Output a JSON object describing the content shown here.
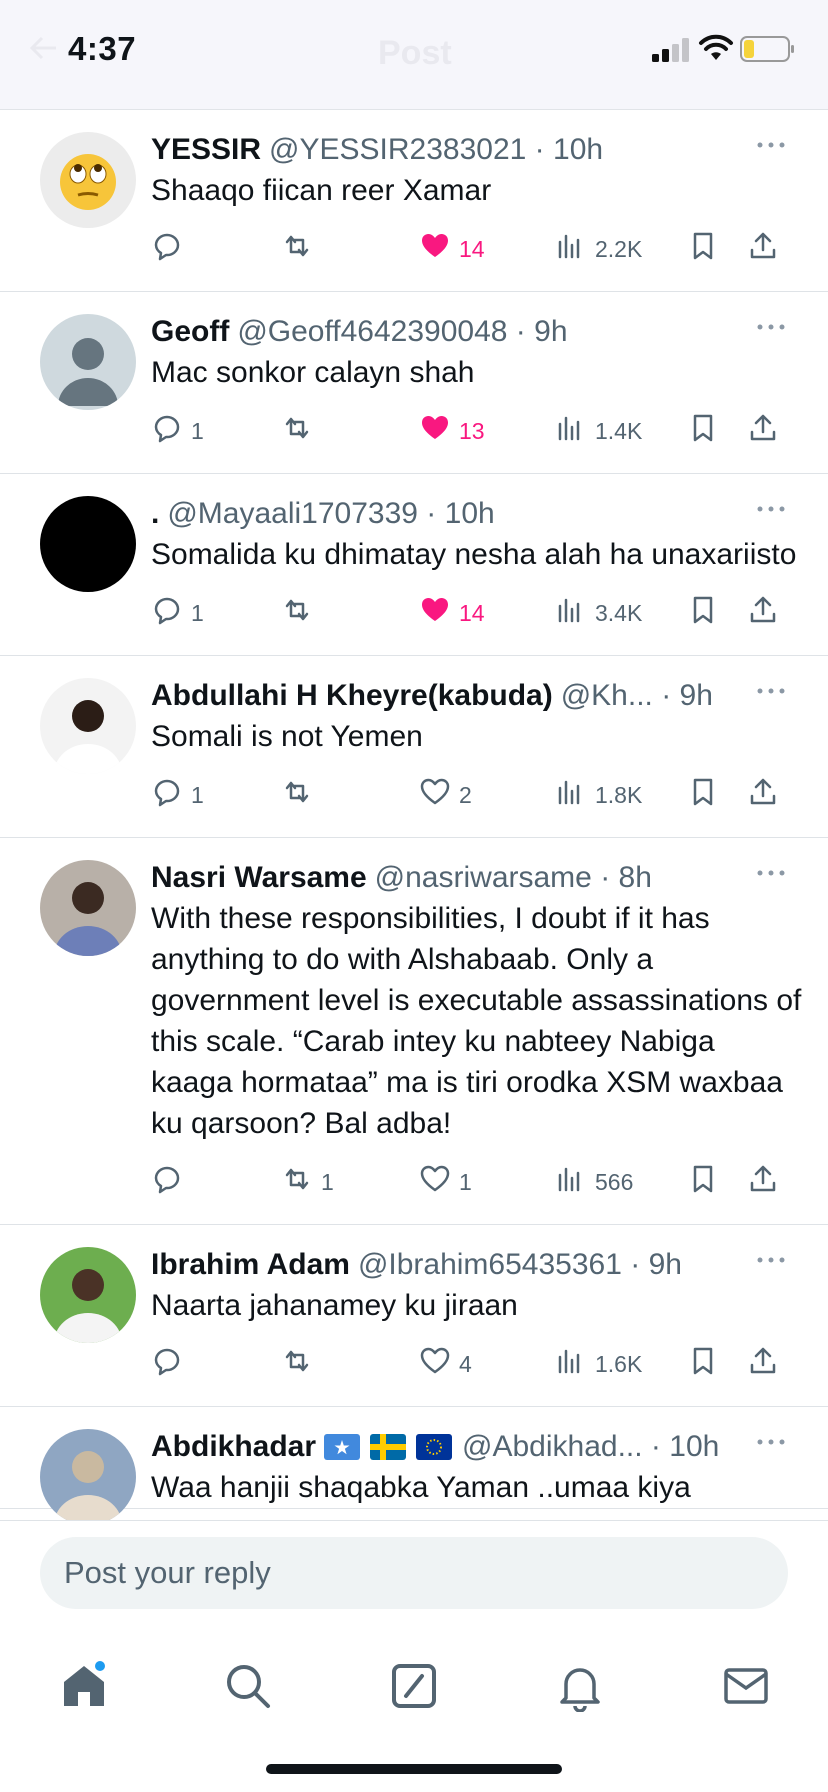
{
  "status_bar": {
    "time": "4:37",
    "faded_title": "Post",
    "battery_color": "#f5d33b"
  },
  "colors": {
    "like_active": "#f91880",
    "secondary_text": "#536471",
    "accent": "#1d9bf0"
  },
  "tweets": [
    {
      "name": "YESSIR",
      "handle": "@YESSIR2383021",
      "time": "10h",
      "text": "Shaaqo fiican reer Xamar",
      "replies": "",
      "retweets": "",
      "likes": "14",
      "liked": true,
      "views": "2.2K",
      "avatar": "face-with-rolling-eyes-emoji"
    },
    {
      "name": "Geoff",
      "handle": "@Geoff4642390048",
      "time": "9h",
      "text": "Mac sonkor calayn shah",
      "replies": "1",
      "retweets": "",
      "likes": "13",
      "liked": true,
      "views": "1.4K",
      "avatar": "default-avatar"
    },
    {
      "name": ".",
      "handle": "@Mayaali1707339",
      "time": "10h",
      "text": "Somalida ku dhimatay nesha  alah ha unaxariisto",
      "replies": "1",
      "retweets": "",
      "likes": "14",
      "liked": true,
      "views": "3.4K",
      "avatar": "black-avatar"
    },
    {
      "name": "Abdullahi H Kheyre(kabuda)",
      "handle": "@Kh...",
      "time": "9h",
      "text": "Somali is not Yemen",
      "replies": "1",
      "retweets": "",
      "likes": "2",
      "liked": false,
      "views": "1.8K",
      "avatar": "photo-avatar"
    },
    {
      "name": "Nasri Warsame",
      "handle": "@nasriwarsame",
      "time": "8h",
      "text": "With these responsibilities, I doubt if it has anything to do with Alshabaab. Only a government level is executable assassinations of this scale. “Carab intey ku nabteey Nabiga kaaga hormataa” ma is tiri orodka XSM waxbaa ku qarsoon? Bal adba!",
      "replies": "",
      "retweets": "1",
      "likes": "1",
      "liked": false,
      "views": "566",
      "avatar": "photo-avatar"
    },
    {
      "name": "Ibrahim Adam",
      "handle": "@Ibrahim65435361",
      "time": "9h",
      "text": "Naarta jahanamey ku jiraan",
      "replies": "",
      "retweets": "",
      "likes": "4",
      "liked": false,
      "views": "1.6K",
      "avatar": "photo-avatar"
    },
    {
      "name": "Abdikhadar",
      "handle": "@Abdikhad...",
      "time": "10h",
      "text": "Waa hanjii shaqabka Yaman ..umaa kiya",
      "replies": "",
      "retweets": "",
      "likes": "",
      "liked": false,
      "views": "",
      "avatar": "photo-avatar"
    }
  ],
  "reply_bar": {
    "placeholder": "Post your reply"
  },
  "tabs": [
    "home",
    "search",
    "grok",
    "notifications",
    "messages"
  ]
}
